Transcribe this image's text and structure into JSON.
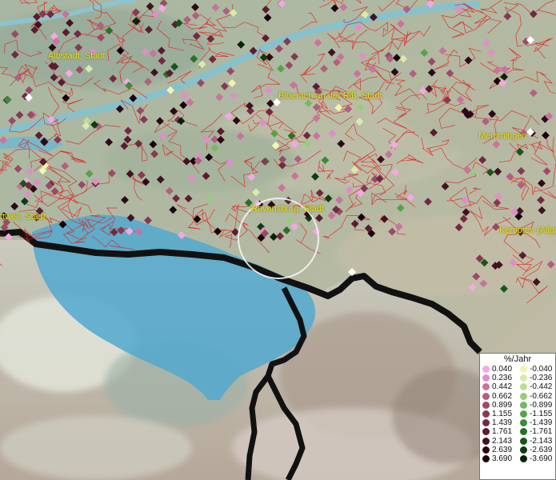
{
  "map": {
    "cities": [
      {
        "name": "Albstadt, Stadt"
      },
      {
        "name": "Biberach an der Riß, Stadt"
      },
      {
        "name": "Memmingen"
      },
      {
        "name": "Ravensburg, Stadt"
      },
      {
        "name": "Kempten (Allgä"
      },
      {
        "name": "ttwell, Stadt"
      }
    ]
  },
  "legend": {
    "title": "%/Jahr",
    "positive": [
      {
        "label": "0.040",
        "color": "#f2a9e3"
      },
      {
        "label": "0.236",
        "color": "#de8fc7"
      },
      {
        "label": "0.442",
        "color": "#c9739f"
      },
      {
        "label": "0.662",
        "color": "#b1607f"
      },
      {
        "label": "0.899",
        "color": "#9b4a66"
      },
      {
        "label": "1.155",
        "color": "#863952"
      },
      {
        "label": "1.439",
        "color": "#712a41"
      },
      {
        "label": "1.761",
        "color": "#5a1d30"
      },
      {
        "label": "2.143",
        "color": "#431222"
      },
      {
        "label": "2.639",
        "color": "#2c0916"
      },
      {
        "label": "3.690",
        "color": "#17030b"
      }
    ],
    "negative": [
      {
        "label": "-0.040",
        "color": "#f2f5b0"
      },
      {
        "label": "-0.236",
        "color": "#d8ecaa"
      },
      {
        "label": "-0.442",
        "color": "#b9de96"
      },
      {
        "label": "-0.662",
        "color": "#98cd7c"
      },
      {
        "label": "-0.899",
        "color": "#77b963"
      },
      {
        "label": "-1.155",
        "color": "#58a24b"
      },
      {
        "label": "-1.439",
        "color": "#3f8a38"
      },
      {
        "label": "-1.761",
        "color": "#2a7027"
      },
      {
        "label": "-2.143",
        "color": "#18561a"
      },
      {
        "label": "-2.639",
        "color": "#0c3c10"
      },
      {
        "label": "-3.690",
        "color": "#062307"
      }
    ]
  }
}
